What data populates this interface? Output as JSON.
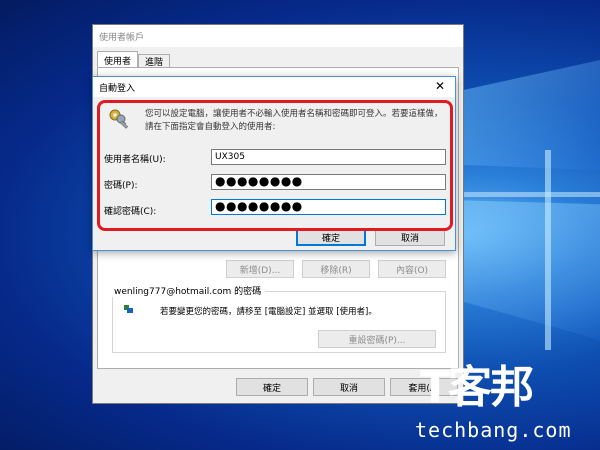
{
  "user_accounts": {
    "title": "使用者帳戶",
    "tabs": [
      "使用者",
      "進階"
    ],
    "buttons": {
      "add": "新增(D)...",
      "remove": "移除(R)",
      "properties": "內容(O)"
    },
    "password_group": {
      "legend": "wenling777@hotmail.com 的密碼",
      "text": "若要變更您的密碼，請移至 [電腦設定] 並選取 [使用者]。",
      "reset_button": "重設密碼(P)..."
    },
    "footer": {
      "ok": "確定",
      "cancel": "取消",
      "apply": "套用(A)"
    }
  },
  "auto_logon": {
    "title": "自動登入",
    "close_glyph": "✕",
    "description": "您可以設定電腦，讓使用者不必輸入使用者名稱和密碼即可登入。若要這樣做，請在下面指定會自動登入的使用者:",
    "username_label": "使用者名稱(U):",
    "username_value": "UX305",
    "password_label": "密碼(P):",
    "password_value": "●●●●●●●●",
    "confirm_label": "確認密碼(C):",
    "confirm_value": "●●●●●●●●",
    "ok": "確定",
    "cancel": "取消"
  },
  "watermark": {
    "logo": "T客邦",
    "url": "techbang.com"
  },
  "icons": {
    "keys": "keys-icon",
    "user_small": "user-icon"
  }
}
